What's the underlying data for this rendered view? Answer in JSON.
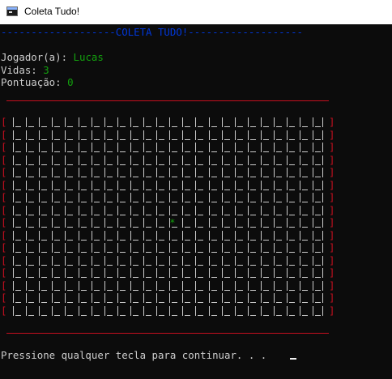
{
  "window": {
    "title": "Coleta Tudo!",
    "icon": "console-window-icon"
  },
  "header": {
    "left_dashes": "-------------------",
    "title": "COLETA TUDO!",
    "right_dashes": "-------------------"
  },
  "player": {
    "name_label": "Jogador(a): ",
    "name_value": "Lucas",
    "lives_label": "Vidas: ",
    "lives_value": "3",
    "score_label": "Pontuação: ",
    "score_value": "0"
  },
  "board": {
    "rows": 16,
    "cols": 24,
    "left_bracket": "[",
    "right_bracket": "]",
    "item_symbol": "*",
    "item_row": 8,
    "item_col": 12
  },
  "prompt": "Pressione qualquer tecla para continuar. . . ",
  "colors": {
    "background": "#0c0c0c",
    "text": "#cccccc",
    "accent_blue": "#0037da",
    "accent_green": "#13a10e",
    "border_red": "#c50f1f"
  }
}
